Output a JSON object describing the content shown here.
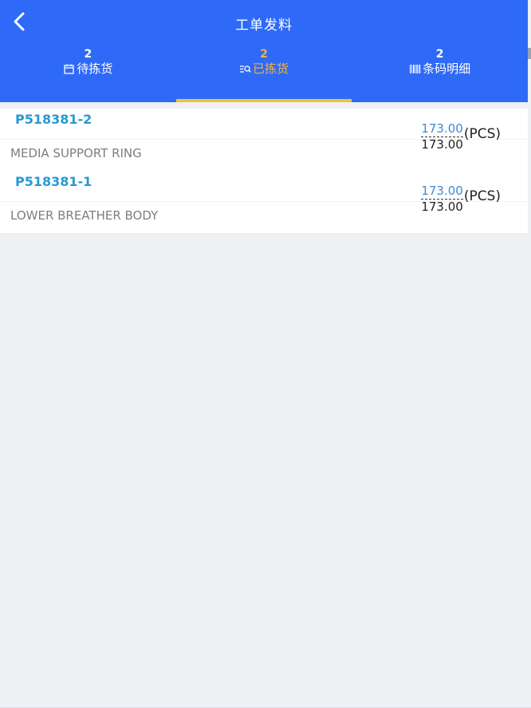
{
  "header": {
    "title": "工单发料"
  },
  "tabs": [
    {
      "count": "2",
      "label": "待拣货",
      "icon": "calendar-icon",
      "active": false
    },
    {
      "count": "2",
      "label": "已拣货",
      "icon": "search-list-icon",
      "active": true
    },
    {
      "count": "2",
      "label": "条码明细",
      "icon": "barcode-icon",
      "active": false
    }
  ],
  "items": [
    {
      "code": "P518381-2",
      "name": "MEDIA SUPPORT RING",
      "picked": "173.00",
      "required": "173.00",
      "unit": "(PCS)"
    },
    {
      "code": "P518381-1",
      "name": "LOWER BREATHER BODY",
      "picked": "173.00",
      "required": "173.00",
      "unit": "(PCS)"
    }
  ],
  "colors": {
    "header_bg": "#2e6af7",
    "active_tab": "#f2b33d",
    "code_text": "#2899d2",
    "picked_qty": "#3f8ad3"
  }
}
